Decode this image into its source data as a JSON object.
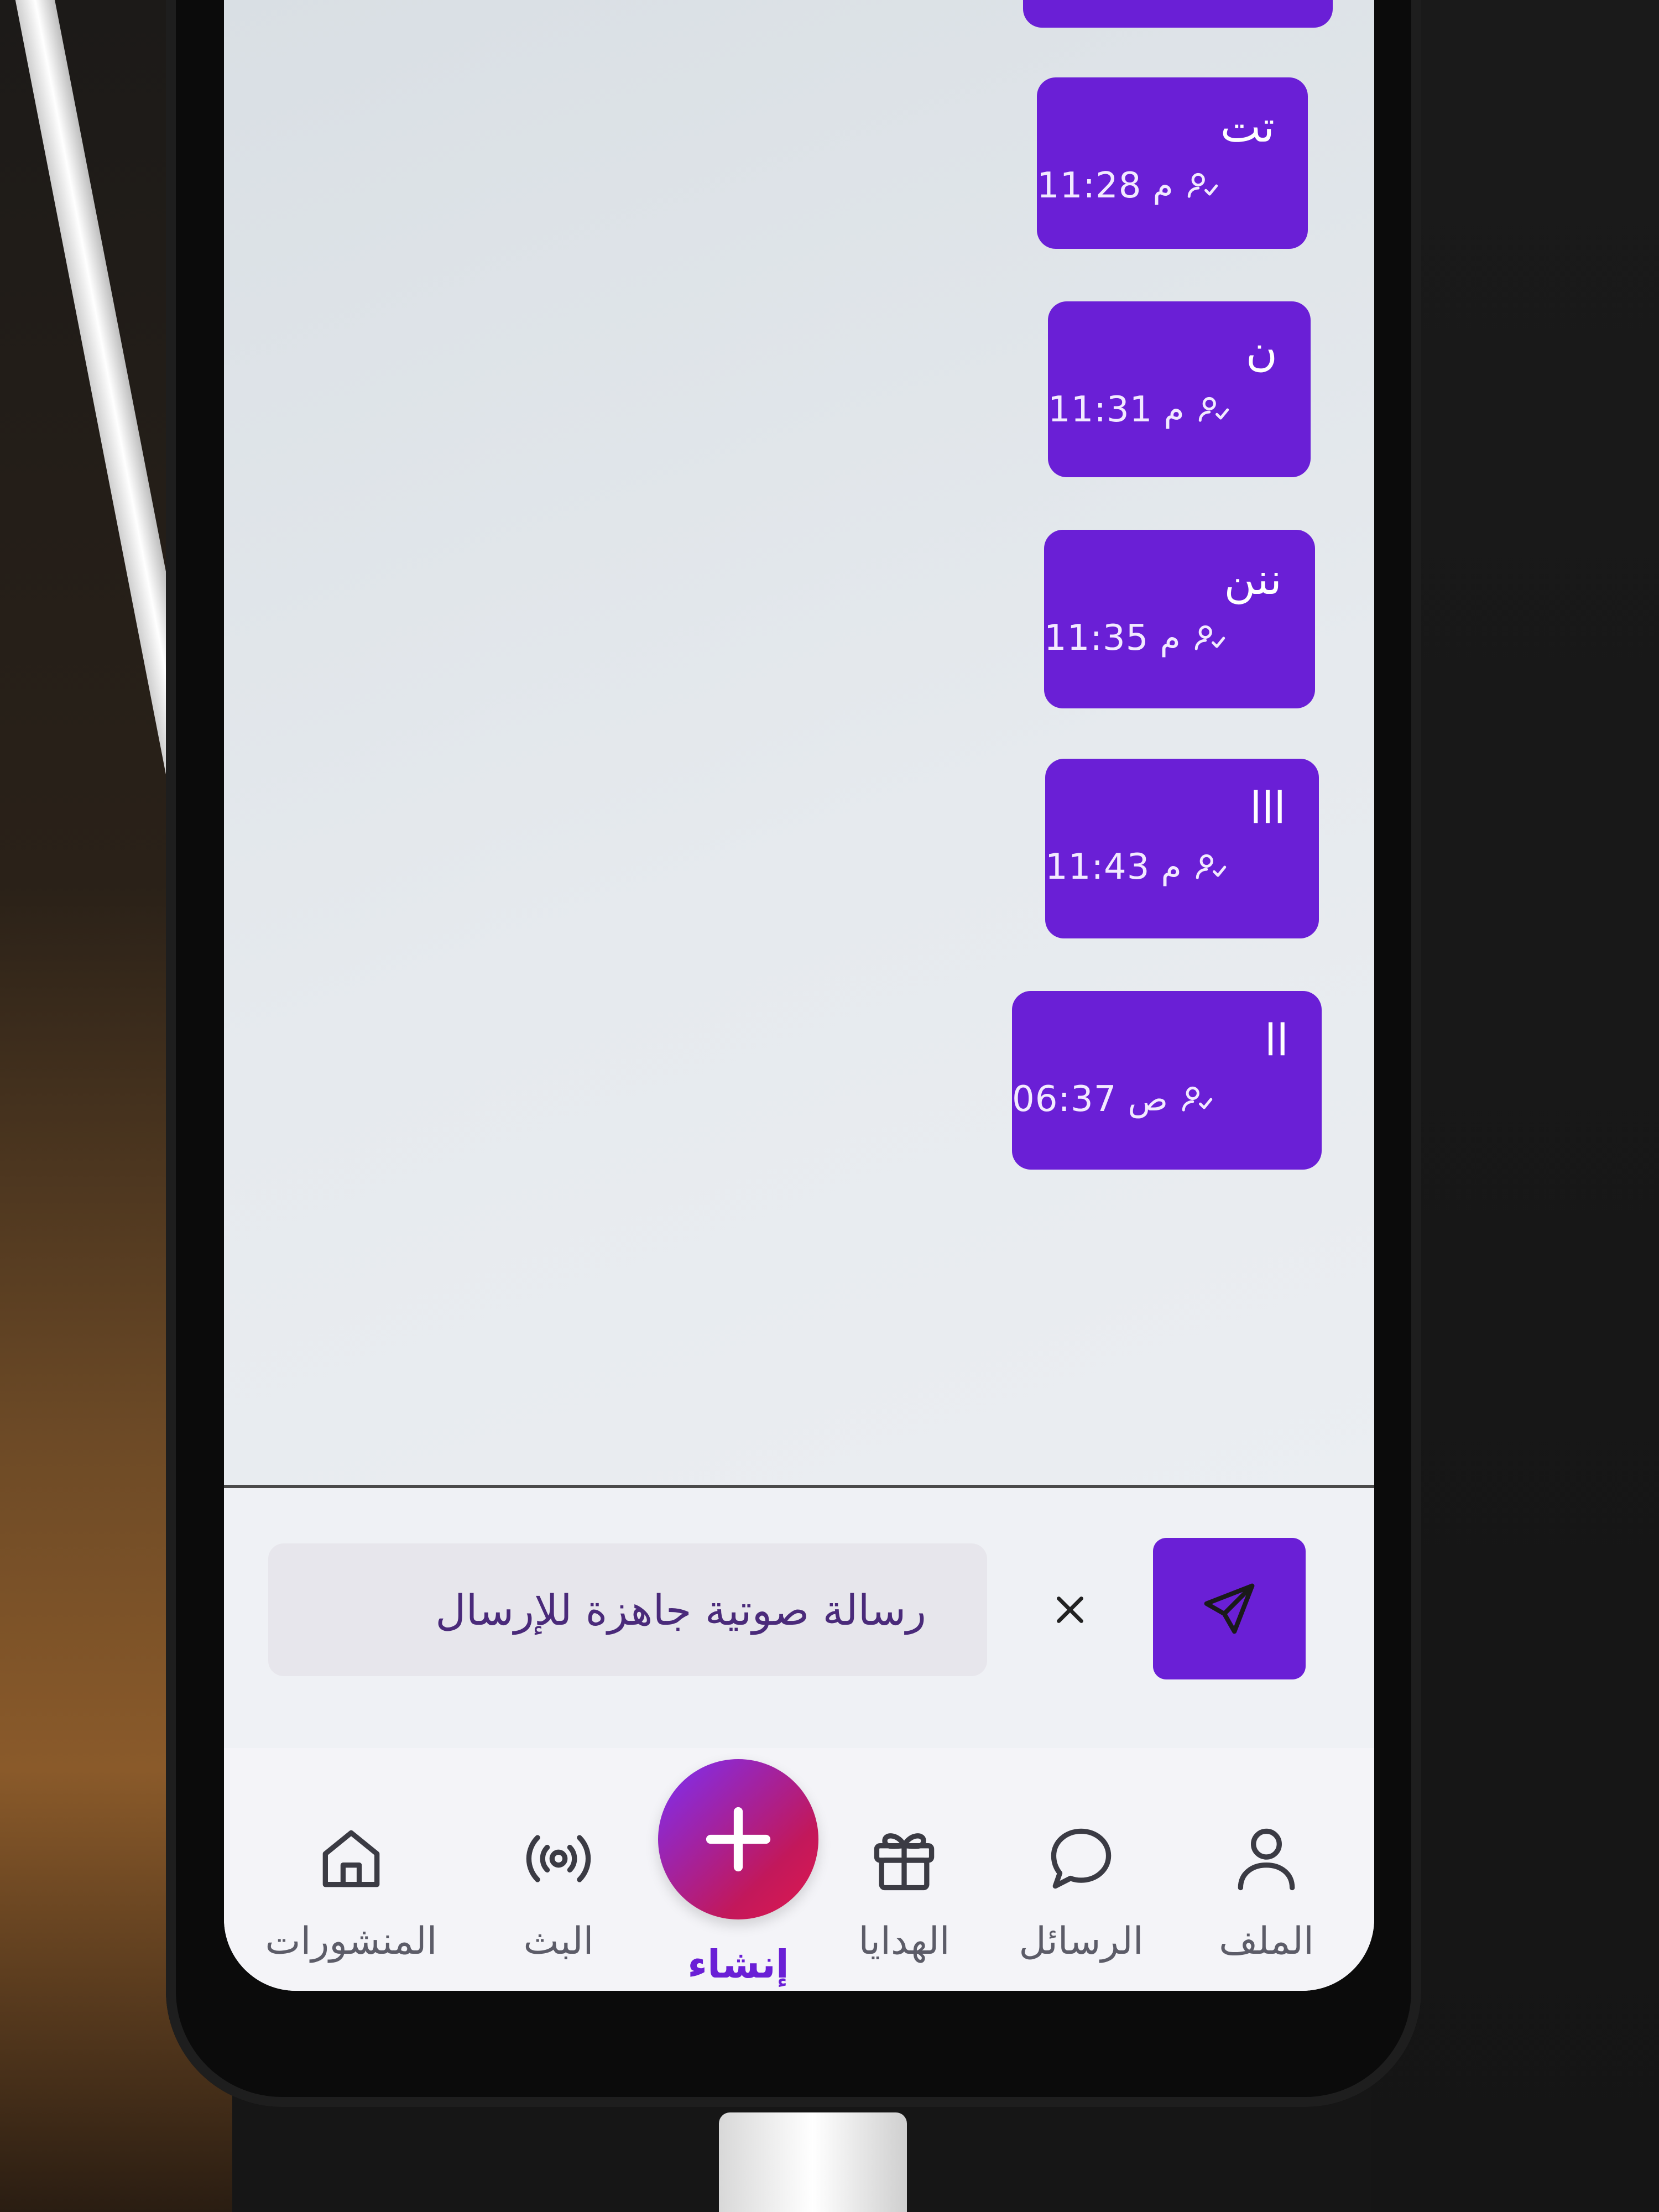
{
  "messages": [
    {
      "text": "تت",
      "time": "11:28",
      "ampm": "م"
    },
    {
      "text": "ن",
      "time": "11:31",
      "ampm": "م"
    },
    {
      "text": "ننن",
      "time": "11:35",
      "ampm": "م"
    },
    {
      "text": "lll",
      "time": "11:43",
      "ampm": "م"
    },
    {
      "text": "ll",
      "time": "06:37",
      "ampm": "ص"
    }
  ],
  "composer": {
    "input_text": "رسالة صوتية جاهزة للإرسال",
    "cancel_icon": "close-icon",
    "send_icon": "send-icon"
  },
  "nav": {
    "items": [
      {
        "label": "الملف",
        "icon": "profile-icon"
      },
      {
        "label": "الرسائل",
        "icon": "chat-bubble-icon"
      },
      {
        "label": "الهدايا",
        "icon": "gift-icon"
      },
      {
        "label": "إنشاء",
        "icon": "plus-icon"
      },
      {
        "label": "البث",
        "icon": "broadcast-icon"
      },
      {
        "label": "المنشورات",
        "icon": "home-icon"
      }
    ]
  },
  "colors": {
    "accent": "#6a1fd6",
    "create_gradient_start": "#7b2ff7",
    "create_gradient_end": "#e0174f"
  }
}
